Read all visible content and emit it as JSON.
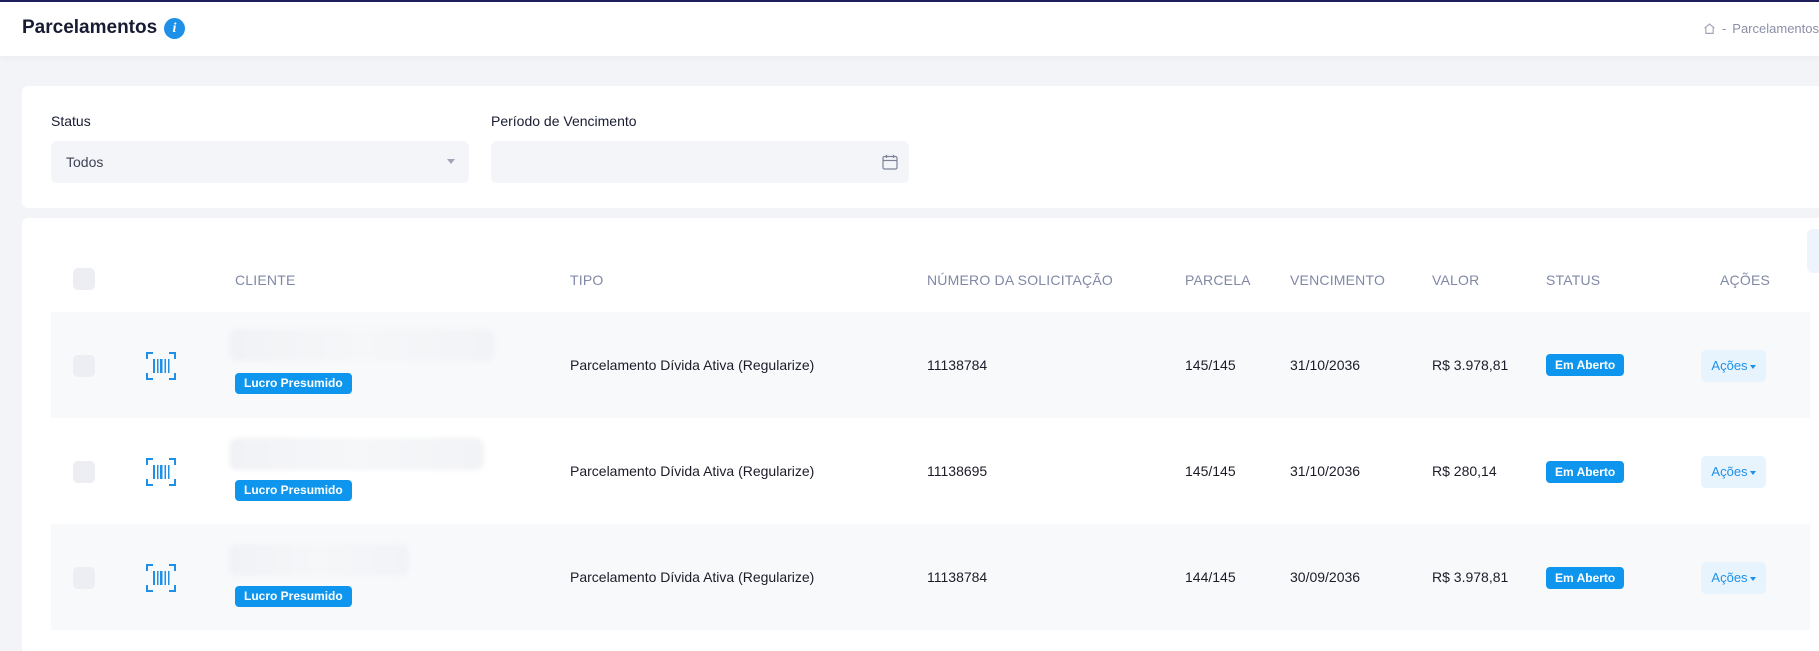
{
  "header": {
    "title": "Parcelamentos",
    "breadcrumb_separator": "-",
    "breadcrumb_current": "Parcelamentos"
  },
  "filters": {
    "status_label": "Status",
    "status_value": "Todos",
    "period_label": "Período de Vencimento",
    "period_value": ""
  },
  "table": {
    "columns": [
      "CLIENTE",
      "TIPO",
      "NÚMERO DA SOLICITAÇÃO",
      "PARCELA",
      "VENCIMENTO",
      "VALOR",
      "STATUS",
      "AÇÕES"
    ],
    "rows": [
      {
        "regime": "Lucro Presumido",
        "tipo": "Parcelamento Dívida Ativa (Regularize)",
        "numero": "11138784",
        "parcela": "145/145",
        "vencimento": "31/10/2036",
        "valor": "R$ 3.978,81",
        "status": "Em Aberto",
        "acoes": "Ações"
      },
      {
        "regime": "Lucro Presumido",
        "tipo": "Parcelamento Dívida Ativa (Regularize)",
        "numero": "11138695",
        "parcela": "145/145",
        "vencimento": "31/10/2036",
        "valor": "R$ 280,14",
        "status": "Em Aberto",
        "acoes": "Ações"
      },
      {
        "regime": "Lucro Presumido",
        "tipo": "Parcelamento Dívida Ativa (Regularize)",
        "numero": "11138784",
        "parcela": "144/145",
        "vencimento": "30/09/2036",
        "valor": "R$ 3.978,81",
        "status": "Em Aberto",
        "acoes": "Ações"
      }
    ]
  },
  "icons": {
    "info": "info-icon",
    "home": "home-icon",
    "calendar": "calendar-icon",
    "barcode": "barcode-icon"
  },
  "colors": {
    "accent": "#0e96ee",
    "header_title": "#181c32",
    "column_header": "#8088a6"
  }
}
